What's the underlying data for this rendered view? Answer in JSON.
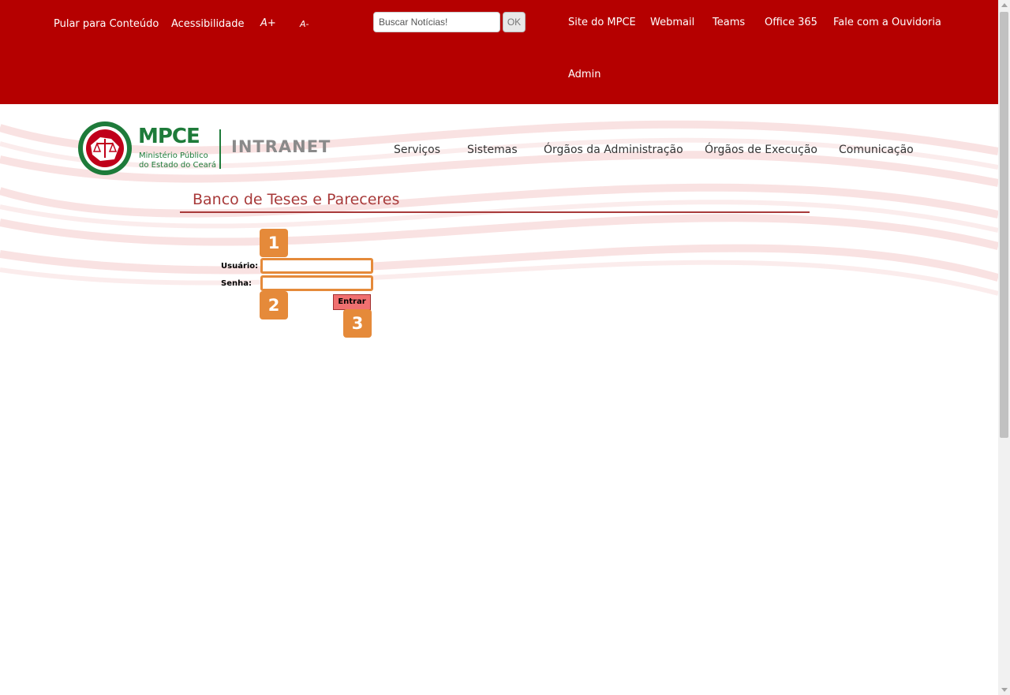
{
  "top_links": {
    "skip": "Pular para Conteúdo",
    "accessibility": "Acessibilidade",
    "font_increase": "A+",
    "font_decrease": "A-",
    "site": "Site do MPCE",
    "webmail": "Webmail",
    "teams": "Teams",
    "office": "Office 365",
    "ouvidoria": "Fale com a Ouvidoria",
    "admin": "Admin"
  },
  "search": {
    "placeholder": "Buscar Notícias!",
    "button": "OK"
  },
  "logo": {
    "acronym": "MPCE",
    "line1": "Ministério Público",
    "line2": "do Estado do Ceará",
    "product": "INTRANET"
  },
  "nav": {
    "servicos": "Serviços",
    "sistemas": "Sistemas",
    "orgaos_admin": "Órgãos da Administração",
    "orgaos_exec": "Órgãos de Execução",
    "comunicacao": "Comunicação"
  },
  "page": {
    "title": "Banco de Teses e Pareceres"
  },
  "form": {
    "user_label": "Usuário:",
    "user_value": "",
    "pass_label": "Senha:",
    "pass_value": "",
    "submit": "Entrar"
  },
  "markers": {
    "m1": "1",
    "m2": "2",
    "m3": "3"
  },
  "colors": {
    "topbar": "#b50000",
    "title": "#a83a3a",
    "marker": "#e58a3a",
    "logo_green": "#1e7b3a",
    "logo_red": "#c0001a"
  }
}
